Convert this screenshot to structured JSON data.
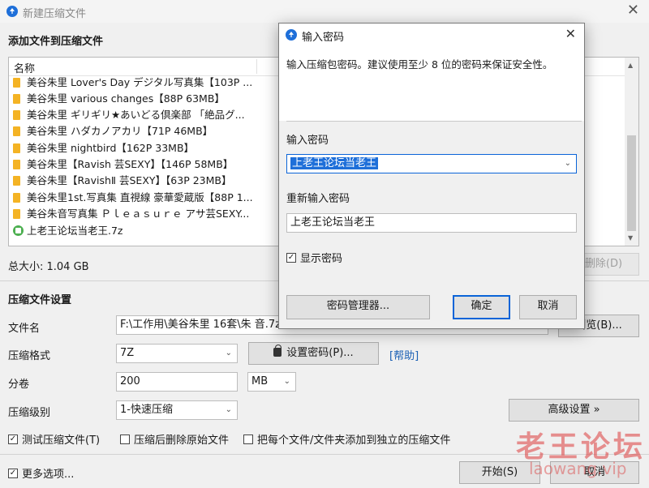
{
  "window": {
    "title": "新建压缩文件"
  },
  "add_section": {
    "title": "添加文件到压缩文件"
  },
  "file_list": {
    "column_name": "名称",
    "items": [
      {
        "name": "美谷朱里 Lover's Day デジタル写真集【103P ...",
        "type": "folder"
      },
      {
        "name": "美谷朱里 various changes【88P 63MB】",
        "type": "folder"
      },
      {
        "name": "美谷朱里 ギリギリ★あいどる倶楽部 「絶品グ...",
        "type": "folder"
      },
      {
        "name": "美谷朱里 ハダカノアカリ【71P 46MB】",
        "type": "folder"
      },
      {
        "name": "美谷朱里 nightbird【162P 33MB】",
        "type": "folder"
      },
      {
        "name": "美谷朱里【Ravish 芸SEXY】【146P 58MB】",
        "type": "folder"
      },
      {
        "name": "美谷朱里【RavishⅡ 芸SEXY】【63P 23MB】",
        "type": "folder"
      },
      {
        "name": "美谷朱里1st.写真集 直視線 豪華愛蔵版【88P 1...",
        "type": "folder"
      },
      {
        "name": "美谷朱音写真集 Ｐｌｅａｓｕｒｅ アサ芸SEXY...",
        "type": "folder"
      },
      {
        "name": "上老王论坛当老王.7z",
        "type": "archive"
      }
    ]
  },
  "total_size": "总大小: 1.04 GB",
  "delete_button": "删除(D)",
  "settings": {
    "title": "压缩文件设置",
    "filename_label": "文件名",
    "filename_value": "F:\\工作用\\美谷朱里 16套\\朱 音.7z",
    "browse_button": "浏览(B)...",
    "format_label": "压缩格式",
    "format_value": "7Z",
    "set_password_button": "设置密码(P)...",
    "help_link": "[帮助]",
    "volume_label": "分卷",
    "volume_value": "200",
    "volume_unit": "MB",
    "level_label": "压缩级别",
    "level_value": "1-快速压缩",
    "advanced_button": "高级设置 »",
    "test_checkbox": "测试压缩文件(T)",
    "delete_after_checkbox": "压缩后删除原始文件",
    "separate_checkbox": "把每个文件/文件夹添加到独立的压缩文件",
    "more_options": "更多选项...",
    "start_button": "开始(S)",
    "cancel_button": "取消"
  },
  "dialog": {
    "title": "输入密码",
    "hint": "输入压缩包密码。建议使用至少 8 位的密码来保证安全性。",
    "password_label": "输入密码",
    "password_value": "上老王论坛当老王",
    "reenter_label": "重新输入密码",
    "reenter_value": "上老王论坛当老王",
    "show_password": "显示密码",
    "manager_button": "密码管理器...",
    "ok_button": "确定",
    "cancel_button": "取消"
  },
  "watermark": {
    "text": "老王论坛",
    "url": "laowang.vip"
  }
}
